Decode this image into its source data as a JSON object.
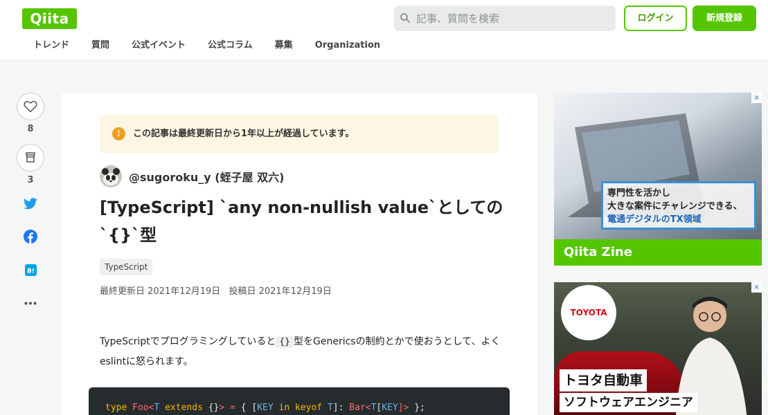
{
  "header": {
    "logo": "Qiita",
    "search_placeholder": "記事、質問を検索",
    "login_label": "ログイン",
    "signup_label": "新規登録",
    "nav": [
      "トレンド",
      "質問",
      "公式イベント",
      "公式コラム",
      "募集",
      "Organization"
    ]
  },
  "actions": {
    "likes": "8",
    "stocks": "3",
    "icons": [
      "heart-icon",
      "stock-icon",
      "twitter-icon",
      "facebook-icon",
      "hatena-bookmark-icon",
      "more-icon"
    ],
    "hatena_label": "B!",
    "more_label": "•••"
  },
  "article": {
    "notice": "この記事は最終更新日から1年以上が経過しています。",
    "notice_icon": "!",
    "author": "@sugoroku_y (蛭子屋 双六)",
    "title": "[TypeScript] `any non-nullish value`としての`{}`型",
    "tag": "TypeScript",
    "updated": "最終更新日 2021年12月19日",
    "posted": "投稿日 2021年12月19日",
    "body_before": "TypeScriptでプログラミングしていると",
    "body_code": "{}",
    "body_after": "型をGenericsの制約とかで使おうとして、よくeslintに怒られます。",
    "code_tokens": [
      {
        "text": "type ",
        "cls": "k"
      },
      {
        "text": "Foo",
        "cls": "r"
      },
      {
        "text": "<",
        "cls": "r"
      },
      {
        "text": "T",
        "cls": "t"
      },
      {
        "text": " extends ",
        "cls": "k"
      },
      {
        "text": "{}",
        "cls": "p"
      },
      {
        "text": "> = ",
        "cls": "r"
      },
      {
        "text": "{ [",
        "cls": "p"
      },
      {
        "text": "KEY",
        "cls": "t"
      },
      {
        "text": " in keyof ",
        "cls": "k"
      },
      {
        "text": "T",
        "cls": "t"
      },
      {
        "text": "]: ",
        "cls": "p"
      },
      {
        "text": "Bar",
        "cls": "r"
      },
      {
        "text": "<",
        "cls": "r"
      },
      {
        "text": "T",
        "cls": "t"
      },
      {
        "text": "[",
        "cls": "p"
      },
      {
        "text": "KEY",
        "cls": "t"
      },
      {
        "text": "]> ",
        "cls": "r"
      },
      {
        "text": "};",
        "cls": "p"
      }
    ]
  },
  "ads": {
    "close_label": "✕",
    "ad1_lines": [
      "専門性を活かし",
      "大きな案件にチャレンジできる、",
      "電通デジタルのTX領域"
    ],
    "ad1_footer": "Qiita Zine",
    "ad2_brand": "TOYOTA",
    "ad2_line1": "トヨタ自動車",
    "ad2_line2": "ソフトウェアエンジニア"
  },
  "colors": {
    "brand": "#55c500",
    "notice_bg": "#fdf6e3",
    "twitter": "#1d9bf0",
    "facebook": "#1877f2",
    "hatena": "#00a4de"
  }
}
